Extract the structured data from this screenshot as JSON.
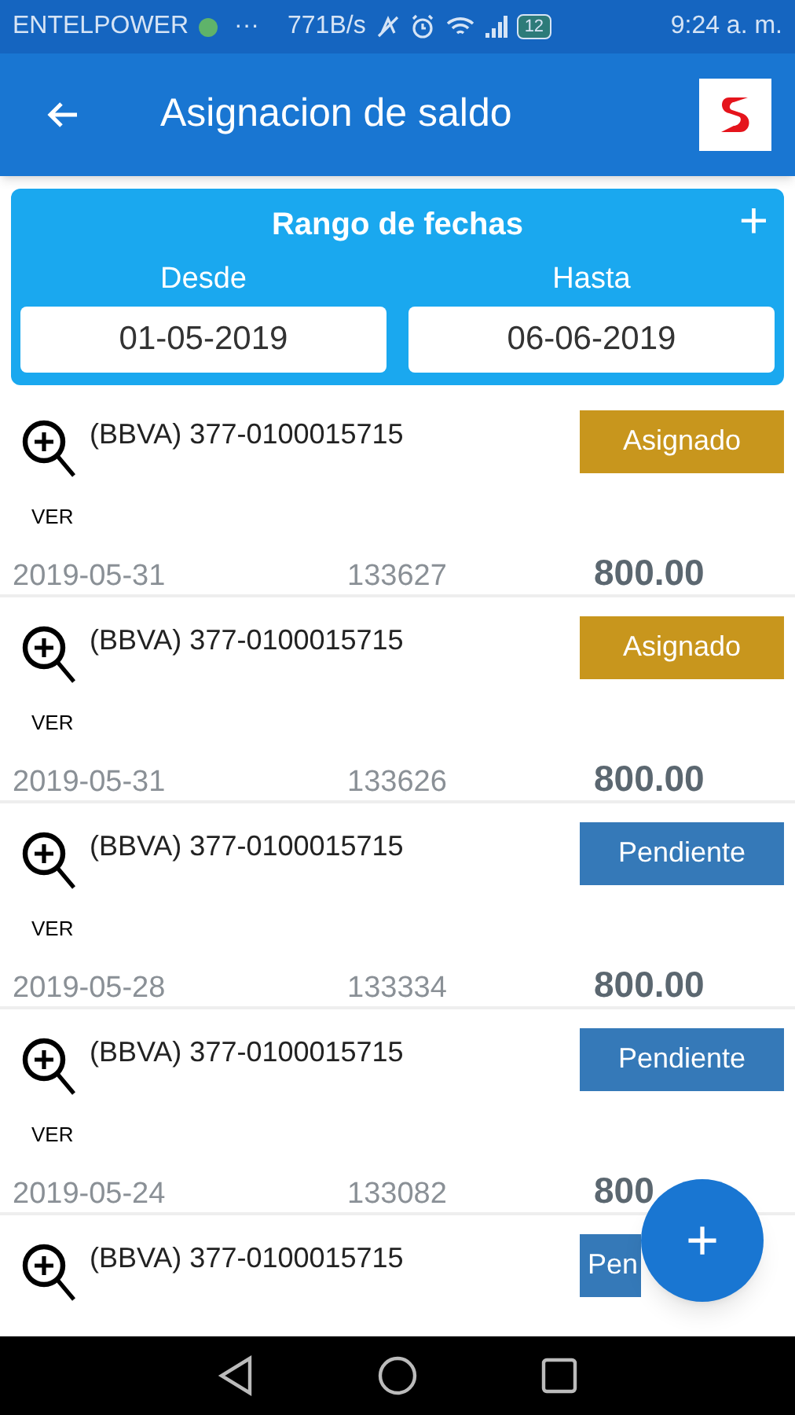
{
  "status_bar": {
    "carrier": "ENTELPOWER",
    "more": "···",
    "speed": "771B/s",
    "battery": "12",
    "time": "9:24 a. m."
  },
  "app_bar": {
    "title": "Asignacion de saldo"
  },
  "date_range": {
    "title": "Rango de fechas",
    "add": "+",
    "from_label": "Desde",
    "from_value": "01-05-2019",
    "to_label": "Hasta",
    "to_value": "06-06-2019"
  },
  "rows": [
    {
      "account": "(BBVA) 377-0100015715",
      "view": "VER",
      "date": "2019-05-31",
      "reference": "133627",
      "amount": "800.00",
      "status": "Asignado",
      "kind": "assigned"
    },
    {
      "account": "(BBVA) 377-0100015715",
      "view": "VER",
      "date": "2019-05-31",
      "reference": "133626",
      "amount": "800.00",
      "status": "Asignado",
      "kind": "assigned"
    },
    {
      "account": "(BBVA) 377-0100015715",
      "view": "VER",
      "date": "2019-05-28",
      "reference": "133334",
      "amount": "800.00",
      "status": "Pendiente",
      "kind": "pending"
    },
    {
      "account": "(BBVA) 377-0100015715",
      "view": "VER",
      "date": "2019-05-24",
      "reference": "133082",
      "amount": "800",
      "status": "Pendiente",
      "kind": "pending"
    },
    {
      "account": "(BBVA) 377-0100015715",
      "status": "Pen",
      "kind": "pending"
    }
  ],
  "fab": {
    "label": "+"
  }
}
